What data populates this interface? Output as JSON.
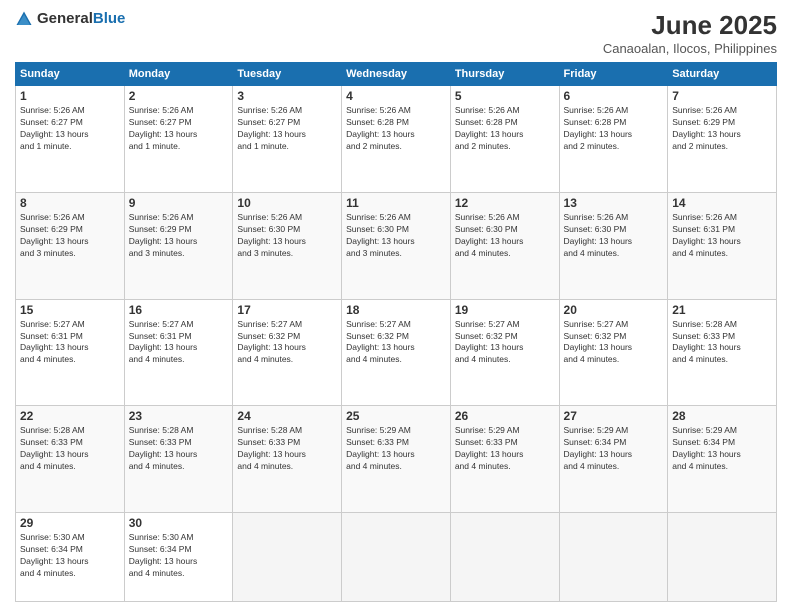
{
  "header": {
    "logo_general": "General",
    "logo_blue": "Blue",
    "title": "June 2025",
    "subtitle": "Canaoalan, Ilocos, Philippines"
  },
  "weekdays": [
    "Sunday",
    "Monday",
    "Tuesday",
    "Wednesday",
    "Thursday",
    "Friday",
    "Saturday"
  ],
  "rows": [
    [
      {
        "day": "1",
        "info": "Sunrise: 5:26 AM\nSunset: 6:27 PM\nDaylight: 13 hours\nand 1 minute."
      },
      {
        "day": "2",
        "info": "Sunrise: 5:26 AM\nSunset: 6:27 PM\nDaylight: 13 hours\nand 1 minute."
      },
      {
        "day": "3",
        "info": "Sunrise: 5:26 AM\nSunset: 6:27 PM\nDaylight: 13 hours\nand 1 minute."
      },
      {
        "day": "4",
        "info": "Sunrise: 5:26 AM\nSunset: 6:28 PM\nDaylight: 13 hours\nand 2 minutes."
      },
      {
        "day": "5",
        "info": "Sunrise: 5:26 AM\nSunset: 6:28 PM\nDaylight: 13 hours\nand 2 minutes."
      },
      {
        "day": "6",
        "info": "Sunrise: 5:26 AM\nSunset: 6:28 PM\nDaylight: 13 hours\nand 2 minutes."
      },
      {
        "day": "7",
        "info": "Sunrise: 5:26 AM\nSunset: 6:29 PM\nDaylight: 13 hours\nand 2 minutes."
      }
    ],
    [
      {
        "day": "8",
        "info": "Sunrise: 5:26 AM\nSunset: 6:29 PM\nDaylight: 13 hours\nand 3 minutes."
      },
      {
        "day": "9",
        "info": "Sunrise: 5:26 AM\nSunset: 6:29 PM\nDaylight: 13 hours\nand 3 minutes."
      },
      {
        "day": "10",
        "info": "Sunrise: 5:26 AM\nSunset: 6:30 PM\nDaylight: 13 hours\nand 3 minutes."
      },
      {
        "day": "11",
        "info": "Sunrise: 5:26 AM\nSunset: 6:30 PM\nDaylight: 13 hours\nand 3 minutes."
      },
      {
        "day": "12",
        "info": "Sunrise: 5:26 AM\nSunset: 6:30 PM\nDaylight: 13 hours\nand 4 minutes."
      },
      {
        "day": "13",
        "info": "Sunrise: 5:26 AM\nSunset: 6:30 PM\nDaylight: 13 hours\nand 4 minutes."
      },
      {
        "day": "14",
        "info": "Sunrise: 5:26 AM\nSunset: 6:31 PM\nDaylight: 13 hours\nand 4 minutes."
      }
    ],
    [
      {
        "day": "15",
        "info": "Sunrise: 5:27 AM\nSunset: 6:31 PM\nDaylight: 13 hours\nand 4 minutes."
      },
      {
        "day": "16",
        "info": "Sunrise: 5:27 AM\nSunset: 6:31 PM\nDaylight: 13 hours\nand 4 minutes."
      },
      {
        "day": "17",
        "info": "Sunrise: 5:27 AM\nSunset: 6:32 PM\nDaylight: 13 hours\nand 4 minutes."
      },
      {
        "day": "18",
        "info": "Sunrise: 5:27 AM\nSunset: 6:32 PM\nDaylight: 13 hours\nand 4 minutes."
      },
      {
        "day": "19",
        "info": "Sunrise: 5:27 AM\nSunset: 6:32 PM\nDaylight: 13 hours\nand 4 minutes."
      },
      {
        "day": "20",
        "info": "Sunrise: 5:27 AM\nSunset: 6:32 PM\nDaylight: 13 hours\nand 4 minutes."
      },
      {
        "day": "21",
        "info": "Sunrise: 5:28 AM\nSunset: 6:33 PM\nDaylight: 13 hours\nand 4 minutes."
      }
    ],
    [
      {
        "day": "22",
        "info": "Sunrise: 5:28 AM\nSunset: 6:33 PM\nDaylight: 13 hours\nand 4 minutes."
      },
      {
        "day": "23",
        "info": "Sunrise: 5:28 AM\nSunset: 6:33 PM\nDaylight: 13 hours\nand 4 minutes."
      },
      {
        "day": "24",
        "info": "Sunrise: 5:28 AM\nSunset: 6:33 PM\nDaylight: 13 hours\nand 4 minutes."
      },
      {
        "day": "25",
        "info": "Sunrise: 5:29 AM\nSunset: 6:33 PM\nDaylight: 13 hours\nand 4 minutes."
      },
      {
        "day": "26",
        "info": "Sunrise: 5:29 AM\nSunset: 6:33 PM\nDaylight: 13 hours\nand 4 minutes."
      },
      {
        "day": "27",
        "info": "Sunrise: 5:29 AM\nSunset: 6:34 PM\nDaylight: 13 hours\nand 4 minutes."
      },
      {
        "day": "28",
        "info": "Sunrise: 5:29 AM\nSunset: 6:34 PM\nDaylight: 13 hours\nand 4 minutes."
      }
    ],
    [
      {
        "day": "29",
        "info": "Sunrise: 5:30 AM\nSunset: 6:34 PM\nDaylight: 13 hours\nand 4 minutes."
      },
      {
        "day": "30",
        "info": "Sunrise: 5:30 AM\nSunset: 6:34 PM\nDaylight: 13 hours\nand 4 minutes."
      },
      {
        "day": "",
        "info": ""
      },
      {
        "day": "",
        "info": ""
      },
      {
        "day": "",
        "info": ""
      },
      {
        "day": "",
        "info": ""
      },
      {
        "day": "",
        "info": ""
      }
    ]
  ]
}
